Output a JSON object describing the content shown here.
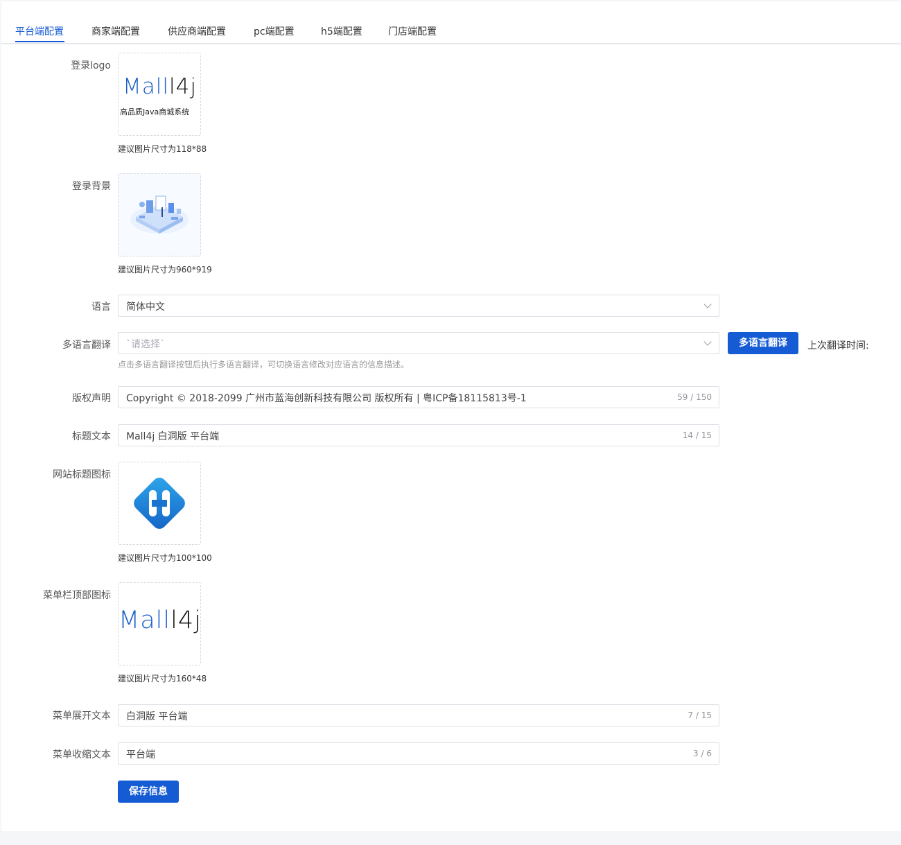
{
  "tabs": [
    {
      "label": "平台端配置",
      "active": true
    },
    {
      "label": "商家端配置"
    },
    {
      "label": "供应商端配置"
    },
    {
      "label": "pc端配置"
    },
    {
      "label": "h5端配置"
    },
    {
      "label": "门店端配置"
    }
  ],
  "form": {
    "login_logo": {
      "label": "登录logo",
      "logo_text_blue": "Mall",
      "logo_text_dark": "4j",
      "logo_caption": "高品质Java商城系统",
      "hint": "建议图片尺寸为118*88"
    },
    "login_bg": {
      "label": "登录背景",
      "hint": "建议图片尺寸为960*919"
    },
    "language": {
      "label": "语言",
      "value": "简体中文"
    },
    "multi_lang": {
      "label": "多语言翻译",
      "placeholder": "`请选择`",
      "button": "多语言翻译",
      "last_time_label": "上次翻译时间:",
      "hint": "点击多语言翻译按钮后执行多语言翻译，可切换语言修改对应语言的信息描述。"
    },
    "copyright": {
      "label": "版权声明",
      "value": "Copyright © 2018-2099 广州市蓝海创新科技有限公司 版权所有 | 粤ICP备18115813号-1",
      "count": "59 / 150"
    },
    "title_text": {
      "label": "标题文本",
      "value": "Mall4j 白洞版 平台端",
      "count": "14 / 15"
    },
    "site_icon": {
      "label": "网站标题图标",
      "hint": "建议图片尺寸为100*100"
    },
    "menu_top_icon": {
      "label": "菜单栏顶部图标",
      "logo_text_blue": "Mall",
      "logo_text_dark": "4j",
      "hint": "建议图片尺寸为160*48"
    },
    "menu_expand": {
      "label": "菜单展开文本",
      "value": "白洞版 平台端",
      "count": "7 / 15"
    },
    "menu_collapse": {
      "label": "菜单收缩文本",
      "value": "平台端",
      "count": "3 / 6"
    },
    "save_button": "保存信息"
  },
  "colors": {
    "primary": "#155bd4",
    "border": "#dcdfe6",
    "background": "#f5f6f7"
  }
}
